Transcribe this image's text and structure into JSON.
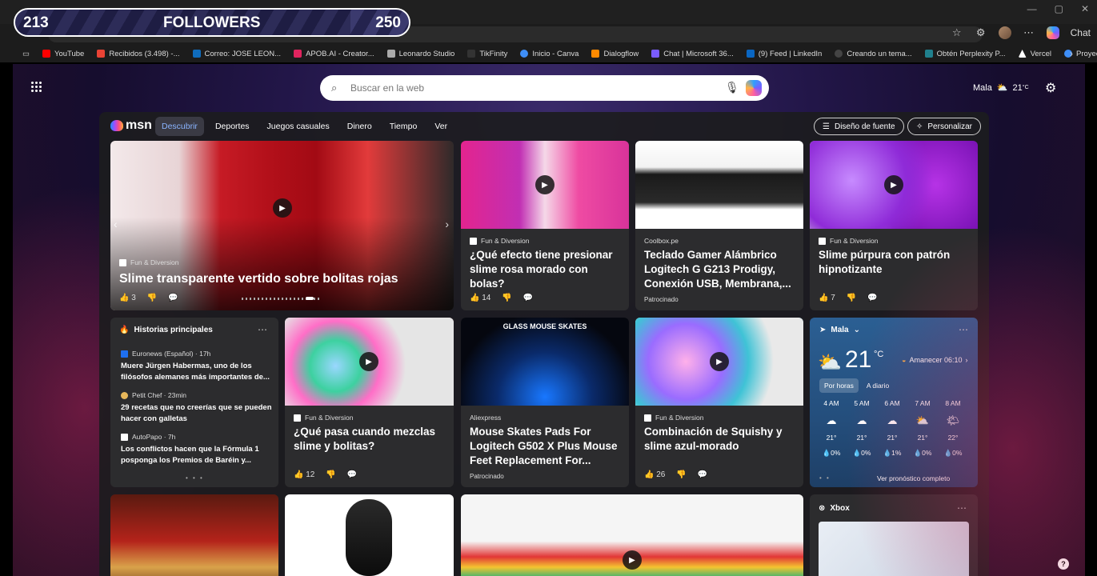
{
  "overlay": {
    "followers_current": "213",
    "followers_label": "FOLLOWERS",
    "followers_goal": "250",
    "progress_fraction": 0.852
  },
  "toolbar": {
    "chat_label": "Chat"
  },
  "bookmarks": [
    {
      "label": "YouTube",
      "color": "#ff0000"
    },
    {
      "label": "Recibidos (3.498) -...",
      "color": "#ea4335"
    },
    {
      "label": "Correo: JOSE LEON...",
      "color": "#0f6cbd"
    },
    {
      "label": "APOB.AI - Creator...",
      "color": "#e0245e"
    },
    {
      "label": "Leonardo Studio",
      "color": "#aaaaaa"
    },
    {
      "label": "TikFinity",
      "color": "#333333"
    },
    {
      "label": "Inicio - Canva",
      "color": "#3e8ef7"
    },
    {
      "label": "Dialogflow",
      "color": "#ff8a00"
    },
    {
      "label": "Chat | Microsoft 36...",
      "color": "#7a5cff"
    },
    {
      "label": "(9) Feed | LinkedIn",
      "color": "#0a66c2"
    },
    {
      "label": "Creando un tema...",
      "color": "#444444"
    },
    {
      "label": "Obtén Perplexity P...",
      "color": "#20808d"
    },
    {
      "label": "Vercel",
      "color": "#ffffff"
    },
    {
      "label": "Proyectos - Canva",
      "color": "#3e8ef7"
    }
  ],
  "search": {
    "placeholder": "Buscar en la web"
  },
  "top_weather": {
    "location": "Mala",
    "temp": "21",
    "unit": "°C"
  },
  "msn": {
    "logo": "msn",
    "tabs": [
      "Descubrir",
      "Deportes",
      "Juegos casuales",
      "Dinero",
      "Tiempo",
      "Ver"
    ],
    "source_design": "Diseño de fuente",
    "personalize": "Personalizar"
  },
  "hero": {
    "source": "Fun & Diversion",
    "title": "Slime transparente vertido sobre bolitas rojas",
    "likes": "3"
  },
  "cards": [
    {
      "source": "Fun & Diversion",
      "title": "¿Qué efecto tiene presionar slime rosa morado con bolas?",
      "likes": "14"
    },
    {
      "source": "Coolbox.pe",
      "title": "Teclado Gamer Alámbrico Logitech G G213 Prodigy, Conexión USB, Membrana,...",
      "sponsored": "Patrocinado"
    },
    {
      "source": "Fun & Diversion",
      "title": "Slime púrpura con patrón hipnotizante",
      "likes": "7"
    },
    {
      "source": "Fun & Diversion",
      "title": "¿Qué pasa cuando mezclas slime y bolitas?",
      "likes": "12"
    },
    {
      "source": "Aliexpress",
      "title": "Mouse Skates Pads For Logitech G502 X Plus Mouse Feet Replacement For...",
      "sponsored": "Patrocinado",
      "banner": "GLASS MOUSE SKATES"
    },
    {
      "source": "Fun & Diversion",
      "title": "Combinación de Squishy y slime azul-morado",
      "likes": "26"
    }
  ],
  "stories": {
    "header": "Historias principales",
    "items": [
      {
        "source": "Euronews (Español) · 17h",
        "title": "Muere Jürgen Habermas, uno de los filósofos alemanes más importantes de..."
      },
      {
        "source": "Petit Chef · 23min",
        "title": "29 recetas que no creerías que se pueden hacer con galletas"
      },
      {
        "source": "AutoPapo · 7h",
        "title": "Los conflictos hacen que la Fórmula 1 posponga los Premios de Baréin y..."
      }
    ]
  },
  "weather": {
    "location": "Mala",
    "temp": "21",
    "unit": "°C",
    "sunrise": "Amanecer 06:10",
    "tab_hourly": "Por horas",
    "tab_daily": "A diario",
    "hours": [
      {
        "time": "4 AM",
        "temp": "21°",
        "rain": "0%",
        "icon": "cloud-moon-icon"
      },
      {
        "time": "5 AM",
        "temp": "21°",
        "rain": "0%",
        "icon": "cloud-moon-icon"
      },
      {
        "time": "6 AM",
        "temp": "21°",
        "rain": "1%",
        "icon": "cloud-moon-icon"
      },
      {
        "time": "7 AM",
        "temp": "21°",
        "rain": "0%",
        "icon": "cloud-sun-icon"
      },
      {
        "time": "8 AM",
        "temp": "22°",
        "rain": "0%",
        "icon": "sun-cloud-icon"
      }
    ],
    "forecast_link": "Ver pronóstico completo"
  },
  "xbox": {
    "header": "Xbox"
  }
}
